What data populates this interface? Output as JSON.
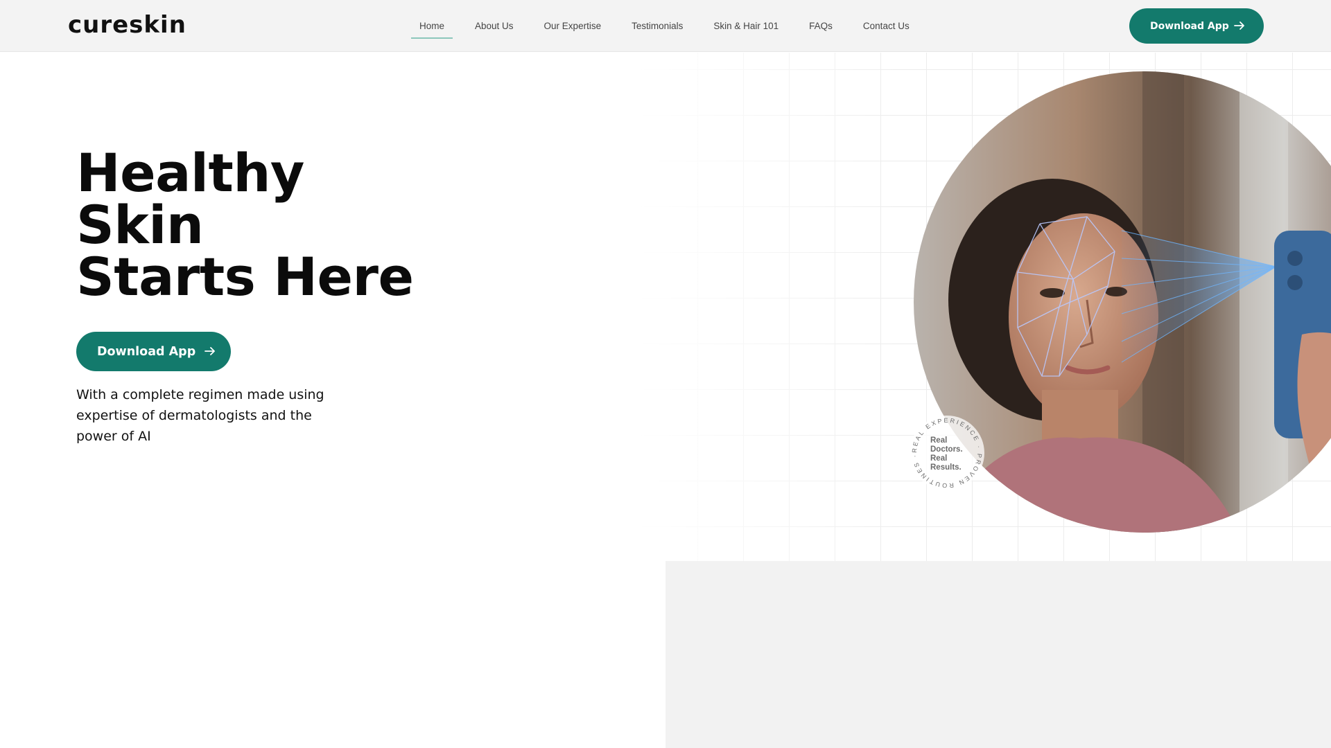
{
  "header": {
    "logo": "cureskin",
    "nav": [
      {
        "label": "Home",
        "active": true
      },
      {
        "label": "About Us"
      },
      {
        "label": "Our Expertise"
      },
      {
        "label": "Testimonials"
      },
      {
        "label": "Skin & Hair 101"
      },
      {
        "label": "FAQs"
      },
      {
        "label": "Contact Us"
      }
    ],
    "cta_label": "Download App"
  },
  "hero": {
    "title_lines": [
      "Healthy",
      "Skin",
      "Starts Here"
    ],
    "cta_label": "Download App",
    "subtitle": "With a complete regimen made using expertise of dermatologists and the power of AI"
  },
  "badge": {
    "ring_text": "REAL EXPERIENCE · PROVEN ROUTINES ·",
    "line1": "Real",
    "line2": "Doctors.",
    "line3": "Real",
    "line4": "Results."
  },
  "colors": {
    "brand_green": "#137a6c",
    "nav_active_underline": "#8cc7bb",
    "header_bg": "#f3f3f3"
  },
  "icons": {
    "button_arrow": "arrow-right-icon"
  }
}
